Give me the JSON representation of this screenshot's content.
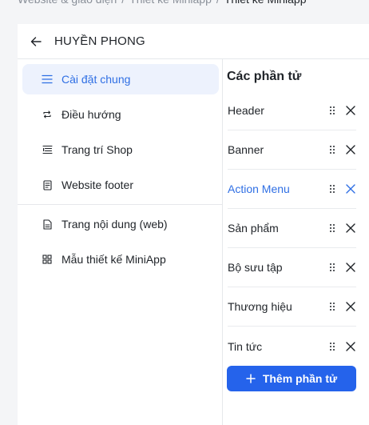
{
  "breadcrumb": {
    "items": [
      "Website & giao diện",
      "Thiết kế Miniapp",
      "Thiết kế Miniapp"
    ],
    "separator": "/"
  },
  "header": {
    "title": "HUYỀN PHONG"
  },
  "sidebar": {
    "items": [
      {
        "label": "Cài đặt chung",
        "icon": "menu-lines-icon",
        "active": true
      },
      {
        "label": "Điều hướng",
        "icon": "repeat-icon"
      },
      {
        "label": "Trang trí Shop",
        "icon": "list-layout-icon"
      },
      {
        "label": "Website footer",
        "icon": "document-icon"
      },
      {
        "label": "Trang nội dung (web)",
        "icon": "file-text-icon"
      },
      {
        "label": "Mẫu thiết kế MiniApp",
        "icon": "grid-icon"
      }
    ]
  },
  "elements": {
    "title": "Các phần tử",
    "items": [
      {
        "label": "Header"
      },
      {
        "label": "Banner"
      },
      {
        "label": "Action Menu",
        "highlight": true
      },
      {
        "label": "Sản phẩm"
      },
      {
        "label": "Bộ sưu tập"
      },
      {
        "label": "Thương hiệu"
      },
      {
        "label": "Tin tức"
      }
    ],
    "add_label": "Thêm phần tử"
  },
  "colors": {
    "accent": "#2f6fe4",
    "button": "#2563eb",
    "active_bg": "#edf2fd"
  }
}
